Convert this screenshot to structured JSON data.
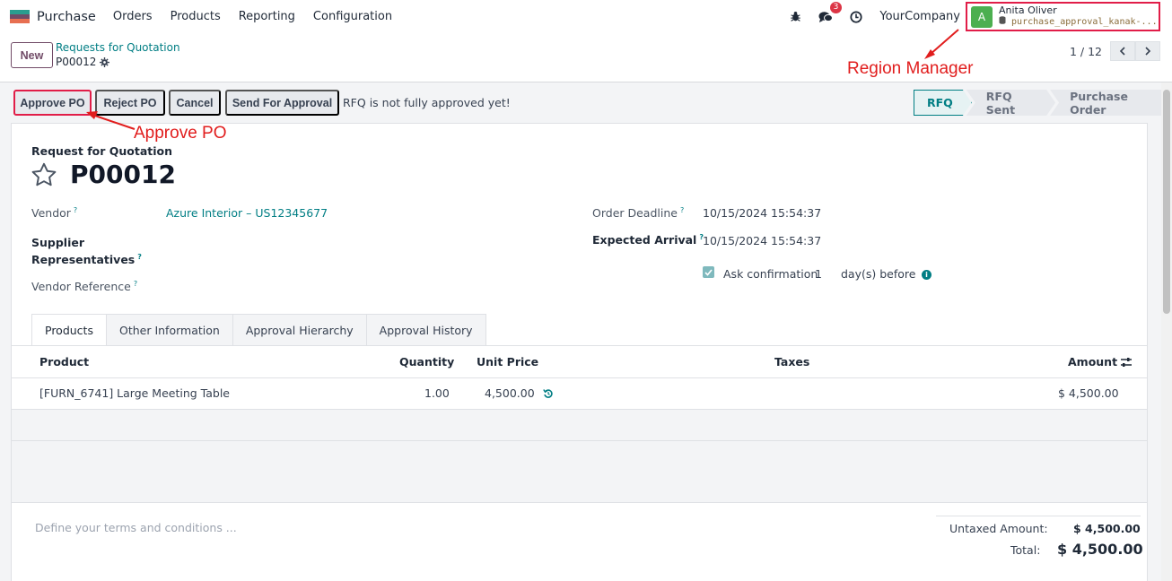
{
  "navbar": {
    "app_name": "Purchase",
    "menu": [
      "Orders",
      "Products",
      "Reporting",
      "Configuration"
    ],
    "messages_count": "3",
    "company": "YourCompany",
    "user": {
      "initial": "A",
      "name": "Anita Oliver",
      "database": "purchase_approval_kanak-..."
    }
  },
  "control_panel": {
    "new_label": "New",
    "breadcrumb": "Requests for Quotation",
    "record": "P00012",
    "pager": "1 / 12"
  },
  "statusbar": {
    "buttons": [
      "Approve PO",
      "Reject PO",
      "Cancel",
      "Send For Approval"
    ],
    "message": "RFQ is not fully approved yet!",
    "stages": [
      "RFQ",
      "RFQ Sent",
      "Purchase Order"
    ],
    "active_stage": "RFQ"
  },
  "form": {
    "type_label": "Request for Quotation",
    "title": "P00012",
    "vendor_label": "Vendor",
    "vendor_value": "Azure Interior – US12345677",
    "supplier_rep_label_1": "Supplier",
    "supplier_rep_label_2": "Representatives",
    "vendor_ref_label": "Vendor Reference",
    "order_deadline_label": "Order Deadline",
    "order_deadline_value": "10/15/2024 15:54:37",
    "expected_arrival_label": "Expected Arrival",
    "expected_arrival_value": "10/15/2024 15:54:37",
    "ask_confirmation_label": "Ask confirmation",
    "ask_confirmation_days": "1",
    "days_before": "day(s) before",
    "help_mark": "?"
  },
  "tabs": [
    "Products",
    "Other Information",
    "Approval Hierarchy",
    "Approval History"
  ],
  "table": {
    "headers": {
      "product": "Product",
      "quantity": "Quantity",
      "unit_price": "Unit Price",
      "taxes": "Taxes",
      "amount": "Amount"
    },
    "rows": [
      {
        "product": "[FURN_6741] Large Meeting Table",
        "quantity": "1.00",
        "unit_price": "4,500.00",
        "taxes": "",
        "amount": "$ 4,500.00"
      }
    ]
  },
  "footer": {
    "terms_placeholder": "Define your terms and conditions ...",
    "untaxed_label": "Untaxed Amount:",
    "untaxed_value": "$ 4,500.00",
    "total_label": "Total:",
    "total_value": "$ 4,500.00"
  },
  "annotations": {
    "region_manager": "Region Manager",
    "approve_po": "Approve PO"
  },
  "colors": {
    "accent": "#017e84",
    "brand": "#714b67",
    "highlight": "#e11d48"
  }
}
